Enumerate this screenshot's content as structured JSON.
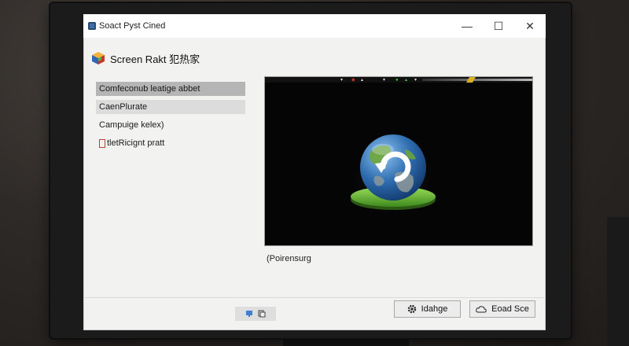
{
  "window": {
    "title": "Soact Pyst Cined",
    "controls": {
      "minimize": "—",
      "maximize": "☐",
      "close": "✕"
    }
  },
  "header": {
    "title": "Screen Rakt 犯热家"
  },
  "menu": {
    "items": [
      {
        "label": "Comfeconub leatige abbet",
        "state": "selected"
      },
      {
        "label": "CaenPlurate",
        "state": "hover"
      },
      {
        "label": "Campuige kelex)",
        "state": "normal"
      },
      {
        "label": "tletRicignt pratt",
        "state": "normal"
      }
    ]
  },
  "preview": {
    "caption": "(Poirensurg",
    "icon": "globe-refresh-icon",
    "status_glyphs": [
      "▾",
      "◆",
      "▴",
      "▾",
      "●",
      "▴",
      "▾"
    ]
  },
  "footer": {
    "toggle_icons": [
      "monitor-icon",
      "copy-icon"
    ],
    "btn_change": {
      "label": "Idahge",
      "icon": "gear-icon"
    },
    "btn_load": {
      "label": "Eoad Sce",
      "icon": "cloud-icon"
    }
  },
  "colors": {
    "accent": "#3f6fa8",
    "globe_blue": "#2f6db0",
    "globe_green": "#6fbf3a"
  }
}
